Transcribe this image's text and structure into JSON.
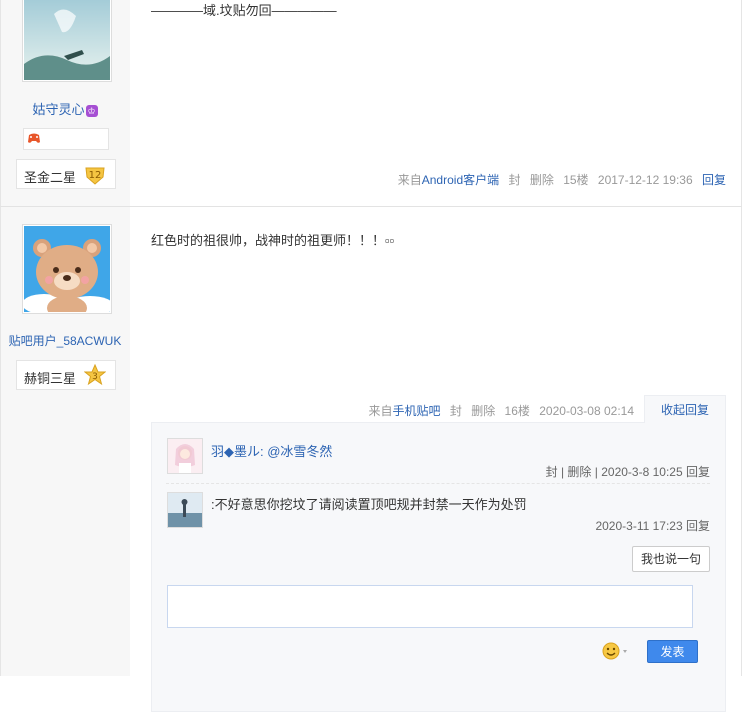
{
  "posts": [
    {
      "username": "姑守灵心",
      "level_name": "圣金二星",
      "level_num": "12",
      "content": "————域.坟贴勿回—————",
      "tail": {
        "from": "来自",
        "client": "Android客户端",
        "ban": "封",
        "delete": "删除",
        "floor": "15楼",
        "time": "2017-12-12 19:36",
        "reply": "回复"
      }
    },
    {
      "username": "贴吧用户_58ACWUK",
      "level_name": "赫铜三星",
      "level_num": "3",
      "content": "红色时的祖很帅，战神时的祖更师！！！▫▫",
      "tail": {
        "from": "来自",
        "client": "手机贴吧",
        "ban": "封",
        "delete": "删除",
        "floor": "16楼",
        "time": "2020-03-08 02:14",
        "collapse": "收起回复"
      }
    }
  ],
  "replies": [
    {
      "user": "羽◆墨ル:",
      "text": " @冰雪冬然",
      "meta_ban": "封",
      "meta_delete": "删除",
      "time": "2020-3-8 10:25",
      "reply": "回复"
    },
    {
      "user": "",
      "text": ":不好意思你挖坟了请阅读置顶吧规并封禁一天作为处罚",
      "time": "2020-3-11 17:23",
      "reply": "回复"
    }
  ],
  "say_button": "我也说一句",
  "send_button": "发表",
  "colors": {
    "link": "#2d64b3",
    "send": "#3f89ec",
    "sidebar": "#f7f7f7"
  }
}
